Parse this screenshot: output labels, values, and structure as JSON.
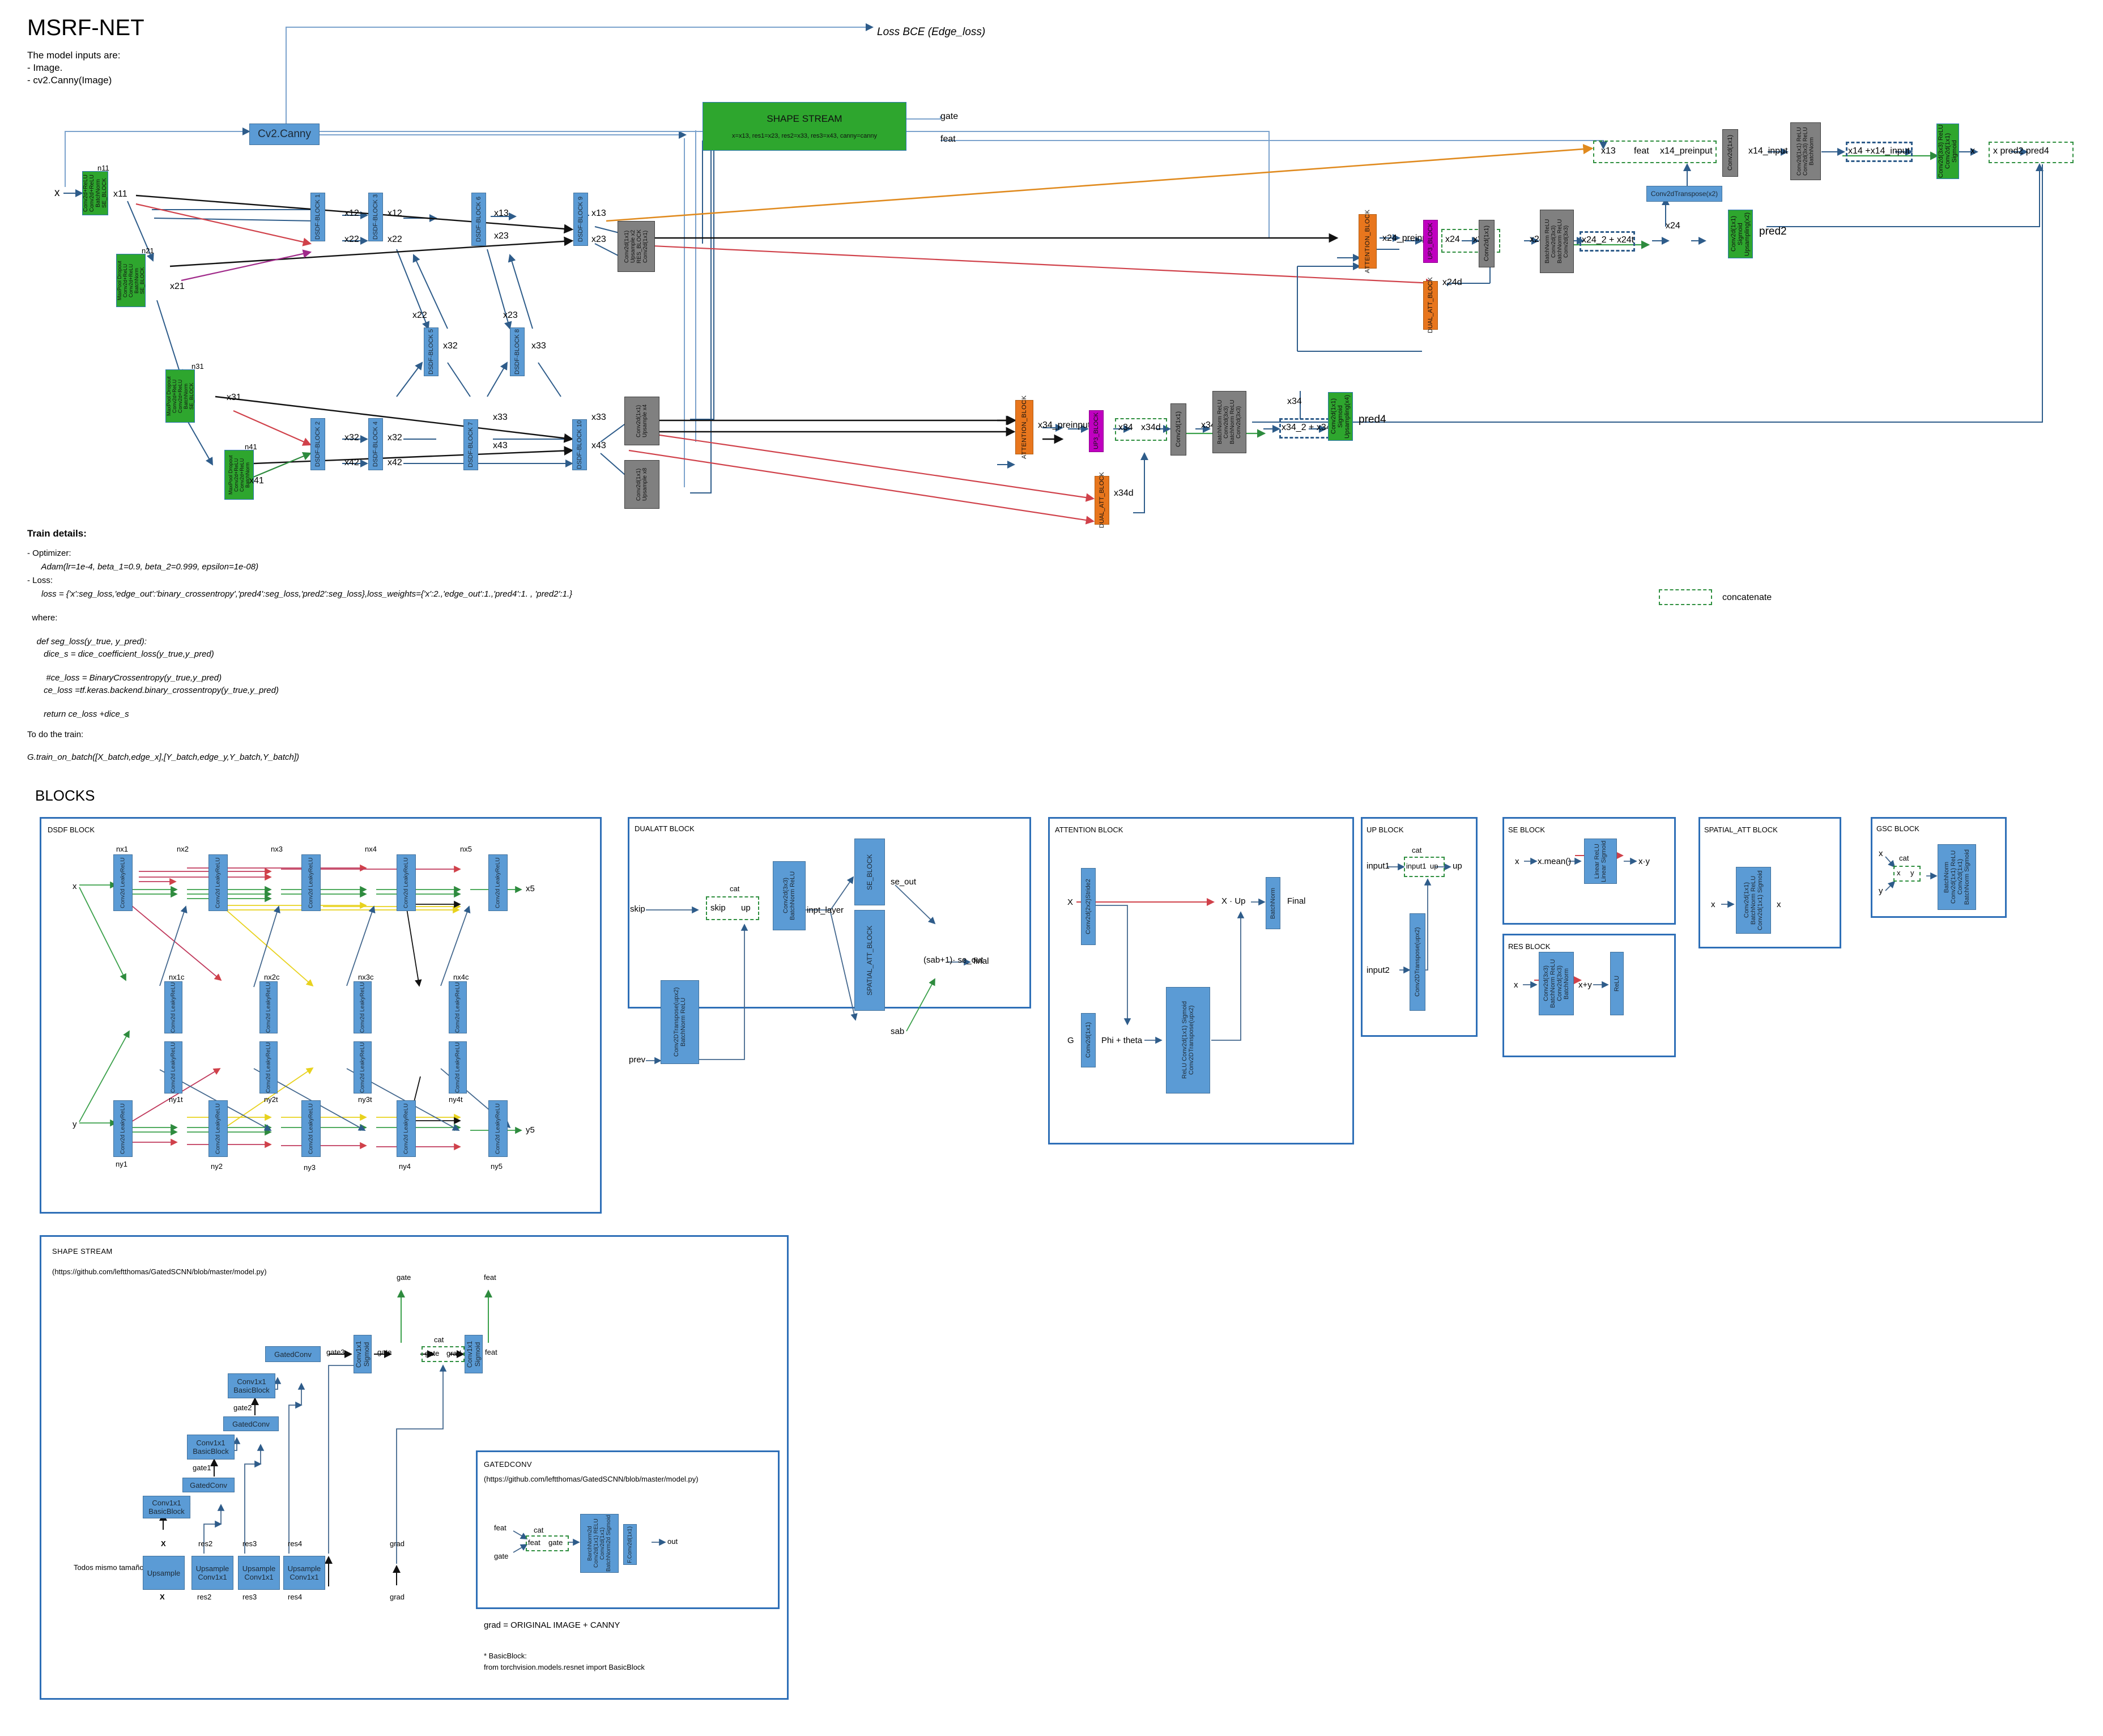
{
  "header": {
    "title": "MSRF-NET",
    "intro_lines": [
      "The model inputs are:",
      "- Image.",
      "- cv2.Canny(Image)"
    ],
    "blocks_heading": "BLOCKS"
  },
  "legend": {
    "concatenate": "concatenate"
  },
  "main_graph": {
    "loss_bce_label": "Loss BCE (Edge_loss)",
    "canny_box": "Cv2.Canny",
    "shape_stream": {
      "title": "SHAPE STREAM",
      "args": "x=x13, res1=x23, res2=x33, res3=x43, canny=canny",
      "out_gate": "gate",
      "out_feat": "feat"
    },
    "input_label": "x",
    "encoder_green": [
      {
        "tag": "n11",
        "lines": [
          "Conv2d+ReLU",
          "Conv2d+ReLU",
          "BatchNorm",
          "SE_BLOCK"
        ],
        "out": "x11"
      },
      {
        "tag": "n21",
        "lines": [
          "MaxPool",
          "Dropout",
          "Conv2d+ReLU",
          "Conv2d+ReLU",
          "BatchNorm",
          "SE_BLOCK"
        ],
        "out": "x21"
      },
      {
        "tag": "n31",
        "lines": [
          "MaxPool",
          "Dropout",
          "Conv2d+ReLU",
          "Conv2d+ReLU",
          "BatchNorm",
          "SE_BLOCK"
        ],
        "out": "x31"
      },
      {
        "tag": "n41",
        "lines": [
          "MaxPool",
          "Dropout",
          "Conv2d+ReLU",
          "Conv2d+ReLU",
          "BatchNorm"
        ],
        "out": "x41"
      }
    ],
    "dsdf_blocks": [
      "DSDF-BLOCK 1",
      "DSDF-BLOCK 3",
      "DSDF-BLOCK 6",
      "DSDF-BLOCK 9",
      "DSDF-BLOCK 5",
      "DSDF-BLOCK 8",
      "DSDF-BLOCK 2",
      "DSDF-BLOCK 4",
      "DSDF-BLOCK 7",
      "DSDF-BLOCK 10"
    ],
    "stream_labels": [
      "x12",
      "x12",
      "x13",
      "x13",
      "x22",
      "x22",
      "x23",
      "x23",
      "x22",
      "x32",
      "x23",
      "x33",
      "x32",
      "x42",
      "x32",
      "x42",
      "x33",
      "x43",
      "x33",
      "x43"
    ],
    "gray_upsamplers": [
      {
        "lines": [
          "Conv2d(1x1)",
          "Upsample x2",
          "RES_BLOCK",
          "Conv2d(1x1)"
        ]
      },
      {
        "lines": [
          "Conv2d(1x1)",
          "Upsample x4"
        ]
      },
      {
        "lines": [
          "Conv2d(1x1)",
          "Upsample x8"
        ]
      }
    ],
    "decoder_top": {
      "attention_block": "ATTENTION_BLOCK",
      "preinput": "x24_preinput",
      "up_block": "UP3_BLOCK",
      "dual_att_block": "DUAL_ATT_BLOCK",
      "cat_left": "x24",
      "cat_right": "x24d",
      "dual_out": "x24d",
      "conv1x1": "Conv2d(1x1)",
      "t_label": "x24t",
      "res_lines": [
        "BatchNorm",
        "ReLU",
        "Conv2d(3x3)",
        "BatchNorm",
        "ReLU",
        "Conv2d(3x3)"
      ],
      "skip_tag": "x24",
      "sum_label": "x24_2 + x24t",
      "transpose": "Conv2dTranspose(x2)",
      "pred_block_lines": [
        "Conv2d(1x1)",
        "Sigmoid",
        "Upsampling(x2)"
      ],
      "pred_label": "pred2"
    },
    "decoder_bottom": {
      "attention_block": "ATTENTION_BLOCK",
      "preinput": "x34_preinput",
      "up_block": "UP3_BLOCK",
      "dual_att_block": "DUAL_ATT_BLOCK",
      "cat_left": "x34",
      "cat_right": "x34d",
      "dual_out": "x34d",
      "conv1x1": "Conv2d(1x1)",
      "t_label": "x34t",
      "res_lines": [
        "BatchNorm",
        "ReLU",
        "Conv2d(3x3)",
        "BatchNorm",
        "ReLU",
        "Conv2d(3x3)"
      ],
      "skip_tag": "x34",
      "sum_label": "x34_2 + x34t",
      "pred_block_lines": [
        "Conv2d(1x1)",
        "Sigmoid",
        "Upsampling(x4)"
      ],
      "pred_label": "pred4"
    },
    "head": {
      "cat_items": [
        "x13",
        "feat",
        "x14_preinput"
      ],
      "conv1x1": "Conv2d(1x1)",
      "x14_input": "x14_input",
      "conv_stack": [
        "Conv2d(1x1)",
        "ReLU",
        "Conv2d(3x3)",
        "ReLU",
        "BatchNorm"
      ],
      "sum_label": "x14 +x14_input",
      "final_block": [
        "Conv2d(3x3)",
        "ReLU",
        "Conv2d(1x1)",
        "Sigmoid"
      ],
      "x_label": "x",
      "out_cat": "x pred2 pred4"
    }
  },
  "train_details": {
    "heading": "Train details:",
    "lines": [
      "- Optimizer:",
      "      Adam(lr=1e-4, beta_1=0.9, beta_2=0.999, epsilon=1e-08)",
      "- Loss:",
      "      loss = {'x':seg_loss,'edge_out':'binary_crossentropy','pred4':seg_loss,'pred2':seg_loss},loss_weights={'x':2.,'edge_out':1.,'pred4':1. , 'pred2':1.}",
      "",
      "  where:",
      "",
      "    def seg_loss(y_true, y_pred):",
      "       dice_s = dice_coefficient_loss(y_true,y_pred)",
      "",
      "        #ce_loss = BinaryCrossentropy(y_true,y_pred)",
      "       ce_loss =tf.keras.backend.binary_crossentropy(y_true,y_pred)",
      "",
      "       return ce_loss +dice_s",
      "",
      "To do the train:",
      "",
      "G.train_on_batch([X_batch,edge_x],[Y_batch,edge_y,Y_batch,Y_batch])"
    ]
  },
  "dsdf_panel": {
    "title": "DSDF BLOCK",
    "input_x": "x",
    "input_y": "y",
    "output_x": "x5",
    "output_y": "y5",
    "top_tags": [
      "nx1",
      "nx2",
      "nx3",
      "nx4",
      "nx5"
    ],
    "mid_top_tags": [
      "nx1c",
      "nx2c",
      "nx3c",
      "nx4c"
    ],
    "mid_bot_tags": [
      "ny1t",
      "ny2t",
      "ny3t",
      "ny4t"
    ],
    "bot_tags": [
      "ny1",
      "ny2",
      "ny3",
      "ny4",
      "ny5"
    ],
    "conv_lines": [
      "Conv2d",
      "LeakyReLU"
    ]
  },
  "dualatt_panel": {
    "title": "DUALATT BLOCK",
    "skip": "skip",
    "prev": "prev",
    "cat": "cat",
    "cat_left": "skip",
    "cat_right": "up",
    "transpose_lines": [
      "Conv2DTranspose(upx2)",
      "BatchNorm",
      "ReLU"
    ],
    "conv_lines": [
      "Conv2d(3x3)",
      "BatchNorm",
      "ReLU"
    ],
    "inpt_layer": "inpt_layer",
    "se_block": "SE_BLOCK",
    "spatial_block": "SPATIAL_ATT_BLOCK",
    "se_out": "se_out",
    "sab": "sab",
    "formula": "(sab+1)· se_out",
    "final": "final"
  },
  "attention_panel": {
    "title": "ATTENTION BLOCK",
    "x": "X",
    "g": "G",
    "conv_x": "Conv2d(2x2)Stride2",
    "conv_g": "Conv2d(1x1)",
    "phi_theta": "Phi + theta",
    "mid_lines": [
      "ReLU",
      "Conv2d(1x1)",
      "Sigmoid",
      "Conv2DTranspose(upx2)"
    ],
    "mult": "X · Up",
    "batchnorm": "BatchNorm",
    "final": "Final"
  },
  "up_panel": {
    "title": "UP BLOCK",
    "input1": "input1",
    "input2": "input2",
    "cat": "cat",
    "cat_left": "input1",
    "cat_right": "up",
    "out": "up",
    "transpose": "Conv2DTranspose(upx2)"
  },
  "se_panel": {
    "title": "SE BLOCK",
    "x": "x",
    "mean": "x.mean()",
    "lines": [
      "Linear",
      "ReLU",
      "Linear",
      "Sigmoid"
    ],
    "out": "x·y"
  },
  "res_panel": {
    "title": "RES BLOCK",
    "x": "x",
    "lines": [
      "Conv2d(3x3)",
      "BatchNorm",
      "ReLU",
      "Conv2d(3x3)",
      "BatchNorm"
    ],
    "sum": "x+y",
    "relu": "ReLU"
  },
  "spatial_panel": {
    "title": "SPATIAL_ATT BLOCK",
    "x_in": "x",
    "lines": [
      "Conv2d(1x1)",
      "BatchNorm",
      "ReLU",
      "Conv2d(1x1)",
      "Sigmoid"
    ],
    "x_out": "x"
  },
  "gsc_panel": {
    "title": "GSC BLOCK",
    "x": "x",
    "y": "y",
    "cat": "cat",
    "cat_left": "x",
    "cat_right": "y",
    "lines": [
      "BatchNorm",
      "Conv2d(1x1)",
      "ReLU",
      "Conv2d(1x1)",
      "BatchNorm",
      "Sigmoid"
    ]
  },
  "shape_panel": {
    "title": "SHAPE STREAM",
    "url": "(https://github.com/leftthomas/GatedSCNN/blob/master/model.py)",
    "note_same_size": "Todos mismo tamaño",
    "upsample_blocks": [
      {
        "lines": [
          "Upsample"
        ],
        "in": "X",
        "out": "X"
      },
      {
        "lines": [
          "Upsample",
          "Conv1x1"
        ],
        "in": "res2",
        "out": "res2"
      },
      {
        "lines": [
          "Upsample",
          "Conv1x1"
        ],
        "in": "res3",
        "out": "res3"
      },
      {
        "lines": [
          "Upsample",
          "Conv1x1"
        ],
        "in": "res4",
        "out": "res4"
      }
    ],
    "grad_in": "grad",
    "grad_mid": "grad",
    "basicblock": [
      "Conv1x1",
      "BasicBlock"
    ],
    "gatedconv": "GatedConv",
    "gate_tags": [
      "gate1",
      "gate2",
      "gate3"
    ],
    "conv_sigmoid": [
      "Conv1x1",
      "Sigmoid"
    ],
    "gate_out": "gate",
    "gate_label": "gate",
    "cat": "cat",
    "cat_left": "gate",
    "cat_right": "grad",
    "feat_label": "feat",
    "feat_out": "feat",
    "grad_note": "grad = ORIGINAL IMAGE + CANNY",
    "basicblock_note": [
      "* BasicBlock:",
      "from torchvision.models.resnet import BasicBlock"
    ]
  },
  "gatedconv_panel": {
    "title": "GATEDCONV",
    "url": "(https://github.com/leftthomas/GatedSCNN/blob/master/model.py)",
    "feat": "feat",
    "gate": "gate",
    "cat": "cat",
    "cat_left": "feat",
    "cat_right": "gate",
    "lines": [
      "BarchNorm2d",
      "Conv2d(1x1)",
      "RELU",
      "Conv2d(1x1)",
      "BatchNorm2d",
      "Sigmoid"
    ],
    "final_conv": "F.Conv2d(1x1)",
    "out": "out"
  },
  "colors": {
    "blue": "#5b9bd5",
    "green": "#2ea62e",
    "gray": "#808080",
    "orange": "#e8761d",
    "purple": "#c000c0",
    "panel_border": "#2e6fb7",
    "cat_dash": "#2f8f3f",
    "red": "#d0414a",
    "orange_line": "#e8a33d",
    "magenta": "#a02a8a"
  }
}
